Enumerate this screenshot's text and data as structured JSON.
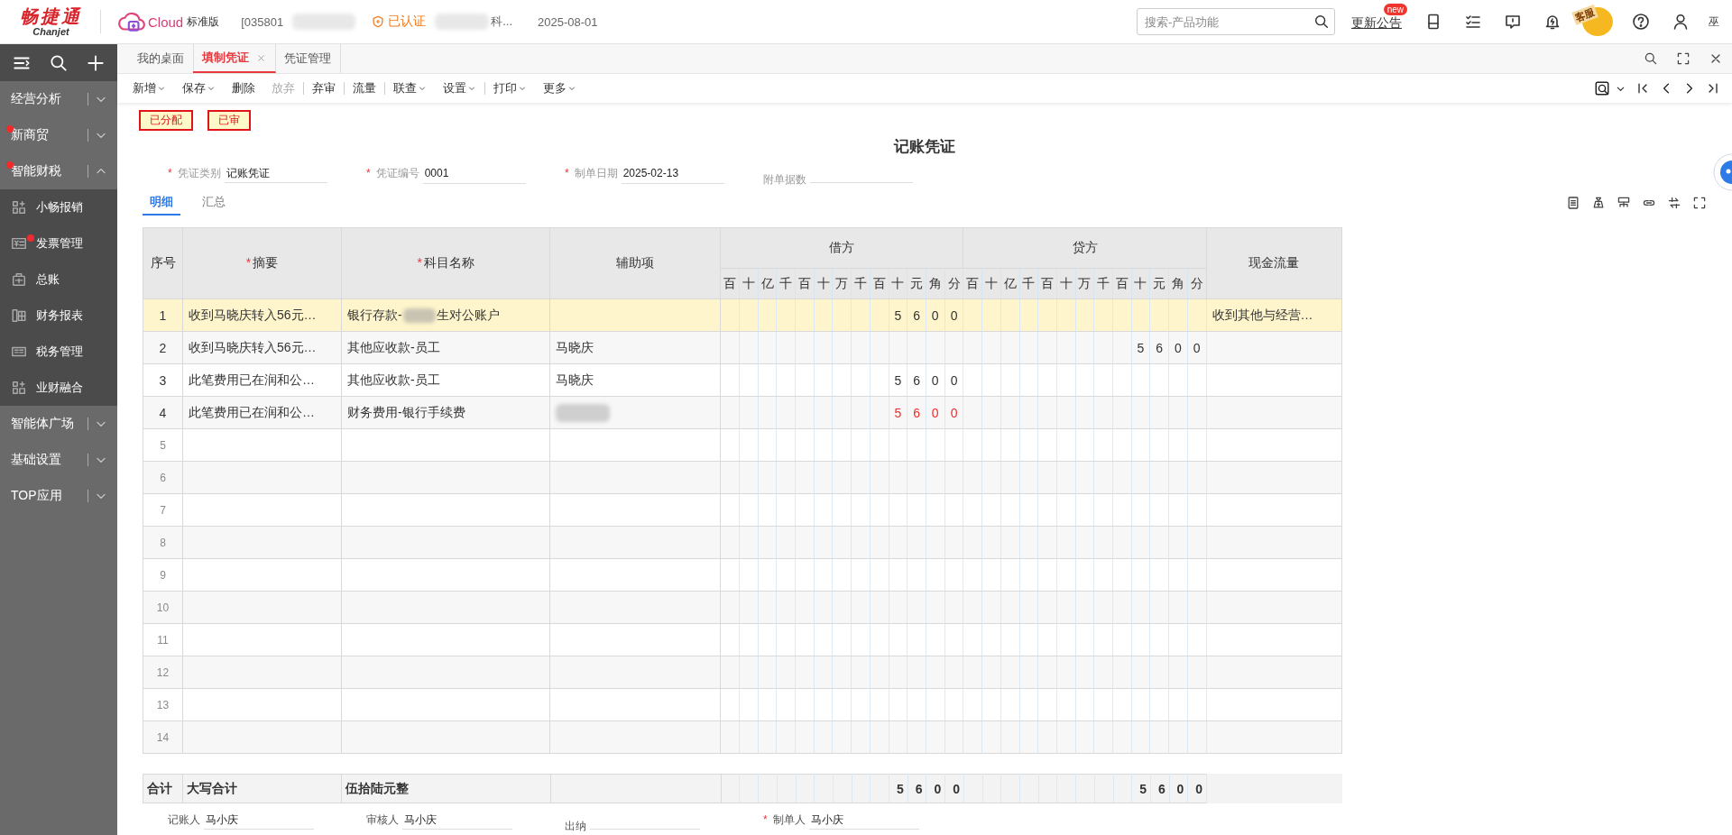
{
  "header": {
    "logo": {
      "name": "畅捷通",
      "subtitle": "Chanjet"
    },
    "product": {
      "brand": "Cloud",
      "edition": "标准版"
    },
    "account": "[035801",
    "certification": "已认证",
    "company": "科...",
    "date": "2025-08-01",
    "search": {
      "placeholder": "搜索-产品功能"
    },
    "announcement": {
      "label": "更新公告",
      "badge": "new"
    },
    "service_label": "客服",
    "user": "巫"
  },
  "sidebar": {
    "groups": [
      {
        "label": "经营分析",
        "dot": false,
        "expanded": false
      },
      {
        "label": "新商贸",
        "dot": true,
        "expanded": false
      },
      {
        "label": "智能财税",
        "dot": true,
        "expanded": true,
        "children": [
          {
            "label": "小畅报销",
            "dot": false
          },
          {
            "label": "发票管理",
            "dot": true
          },
          {
            "label": "总账",
            "dot": false
          },
          {
            "label": "财务报表",
            "dot": false
          },
          {
            "label": "税务管理",
            "dot": false
          },
          {
            "label": "业财融合",
            "dot": false
          }
        ]
      },
      {
        "label": "智能体广场",
        "dot": false,
        "expanded": false
      },
      {
        "label": "基础设置",
        "dot": false,
        "expanded": false
      },
      {
        "label": "TOP应用",
        "dot": false,
        "expanded": false
      }
    ]
  },
  "tabs": [
    {
      "label": "我的桌面",
      "selected": false,
      "closable": false
    },
    {
      "label": "填制凭证",
      "selected": true,
      "closable": true
    },
    {
      "label": "凭证管理",
      "selected": false,
      "closable": false
    }
  ],
  "toolbar": [
    {
      "label": "新增",
      "dropdown": true,
      "disabled": false,
      "separator_after": false
    },
    {
      "label": "保存",
      "dropdown": true,
      "disabled": false,
      "separator_after": false
    },
    {
      "label": "删除",
      "dropdown": false,
      "disabled": false,
      "separator_after": false
    },
    {
      "label": "放弃",
      "dropdown": false,
      "disabled": true,
      "separator_after": true
    },
    {
      "label": "弃审",
      "dropdown": false,
      "disabled": false,
      "separator_after": true
    },
    {
      "label": "流量",
      "dropdown": false,
      "disabled": false,
      "separator_after": true
    },
    {
      "label": "联查",
      "dropdown": true,
      "disabled": false,
      "separator_after": false
    },
    {
      "label": "设置",
      "dropdown": true,
      "disabled": false,
      "separator_after": true
    },
    {
      "label": "打印",
      "dropdown": true,
      "disabled": false,
      "separator_after": false
    },
    {
      "label": "更多",
      "dropdown": true,
      "disabled": false,
      "separator_after": false
    }
  ],
  "stamps": [
    "已分配",
    "已审"
  ],
  "voucher": {
    "title": "记账凭证",
    "fields": [
      {
        "required_mark": "*",
        "label": "凭证类别",
        "value": "记账凭证"
      },
      {
        "required_mark": "*",
        "label": "凭证编号",
        "value": "0001"
      },
      {
        "required_mark": "*",
        "label": "制单日期",
        "value": "2025-02-13"
      },
      {
        "label": "附单据数"
      }
    ]
  },
  "detail_tabs": [
    {
      "label": "明细",
      "selected": true
    },
    {
      "label": "汇总",
      "selected": false
    }
  ],
  "table": {
    "columns": [
      {
        "label": "序号"
      },
      {
        "required_mark": "*",
        "label": "摘要"
      },
      {
        "required_mark": "*",
        "label": "科目名称"
      },
      {
        "label": "辅助项"
      }
    ],
    "debit": {
      "label": "借方",
      "units": [
        "百",
        "十",
        "亿",
        "千",
        "百",
        "十",
        "万",
        "千",
        "百",
        "十",
        "元",
        "角",
        "分"
      ]
    },
    "credit": {
      "label": "贷方",
      "units": [
        "百",
        "十",
        "亿",
        "千",
        "百",
        "十",
        "万",
        "千",
        "百",
        "十",
        "元",
        "角",
        "分"
      ]
    },
    "cash_flow": "现金流量",
    "rows": [
      {
        "no": "1",
        "selected": true,
        "summary": "收到马晓庆转入56元…",
        "subject": [
          "银行存款-",
          "生对公账户"
        ],
        "aux_redacted": false,
        "debit_digits": [
          "5",
          "6",
          "0",
          "0"
        ],
        "negative": false,
        "cash_flow": "收到其他与经营…"
      },
      {
        "no": "2",
        "selected": false,
        "summary": "收到马晓庆转入56元…",
        "subject": [
          "其他应收款-员工"
        ],
        "aux": "马晓庆",
        "credit_digits": [
          "5",
          "6",
          "0",
          "0"
        ],
        "negative": false
      },
      {
        "no": "3",
        "selected": false,
        "summary": "此笔费用已在润和公…",
        "subject": [
          "其他应收款-员工"
        ],
        "aux": "马晓庆",
        "debit_digits": [
          "5",
          "6",
          "0",
          "0"
        ],
        "negative": false
      },
      {
        "no": "4",
        "selected": false,
        "summary": "此笔费用已在润和公…",
        "subject": [
          "财务费用-银行手续费"
        ],
        "aux_redacted": true,
        "debit_digits": [
          "5",
          "6",
          "0",
          "0"
        ],
        "negative": true
      },
      {
        "no": "5",
        "selected": false
      },
      {
        "no": "6",
        "selected": false
      },
      {
        "no": "7",
        "selected": false
      },
      {
        "no": "8",
        "selected": false
      },
      {
        "no": "9",
        "selected": false
      },
      {
        "no": "10",
        "selected": false
      },
      {
        "no": "11",
        "selected": false
      },
      {
        "no": "12",
        "selected": false
      },
      {
        "no": "13",
        "selected": false
      },
      {
        "no": "14",
        "selected": false
      }
    ]
  },
  "totals": {
    "label": "合计",
    "caps_label": "大写合计",
    "caps_value": "伍拾陆元整",
    "debit_digits": [
      "5",
      "6",
      "0",
      "0"
    ],
    "credit_digits": [
      "5",
      "6",
      "0",
      "0"
    ]
  },
  "signatures": [
    {
      "label": "记账人",
      "value": "马小庆"
    },
    {
      "label": "审核人",
      "value": "马小庆"
    },
    {
      "label": "出纳"
    },
    {
      "required_mark": "*",
      "label": "制单人",
      "value": "马小庆"
    }
  ]
}
